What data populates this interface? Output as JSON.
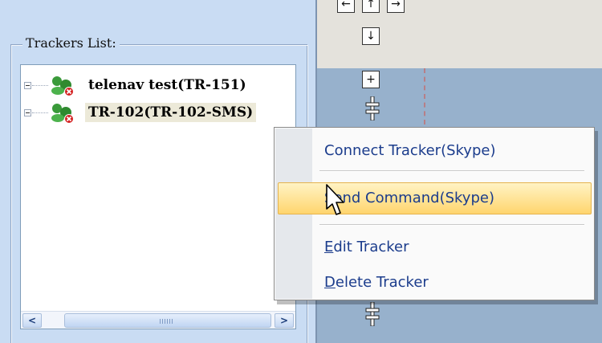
{
  "trackers_list": {
    "title": "Trackers List:",
    "items": [
      {
        "label": "telenav test(TR-151)",
        "selected": false
      },
      {
        "label": "TR-102(TR-102-SMS)",
        "selected": true
      }
    ]
  },
  "scrollbar": {
    "left_icon": "scroll-left-arrow",
    "right_icon": "scroll-right-arrow"
  },
  "map_nav": {
    "icons": [
      "pan-left-icon",
      "pan-up-icon",
      "pan-right-icon",
      "pan-down-icon",
      "zoom-in-icon",
      "zoom-slider-icon"
    ],
    "zoom_in_symbol": "+",
    "down_symbol": "↓"
  },
  "context_menu": {
    "items": [
      {
        "key": "connect",
        "label": "Connect Tracker(Skype)",
        "accel": ""
      },
      {
        "key": "send",
        "label": "Send Command(Skype)",
        "accel": "S",
        "highlighted": true
      },
      {
        "key": "edit",
        "label": "dit Tracker",
        "accel": "E"
      },
      {
        "key": "delete",
        "label": "elete Tracker",
        "accel": "D"
      }
    ]
  },
  "colors": {
    "pane_bg": "#c9dcf3",
    "map_bg": "#97b1cc",
    "menu_text": "#1b3c8c",
    "highlight": "#ffd56e"
  }
}
